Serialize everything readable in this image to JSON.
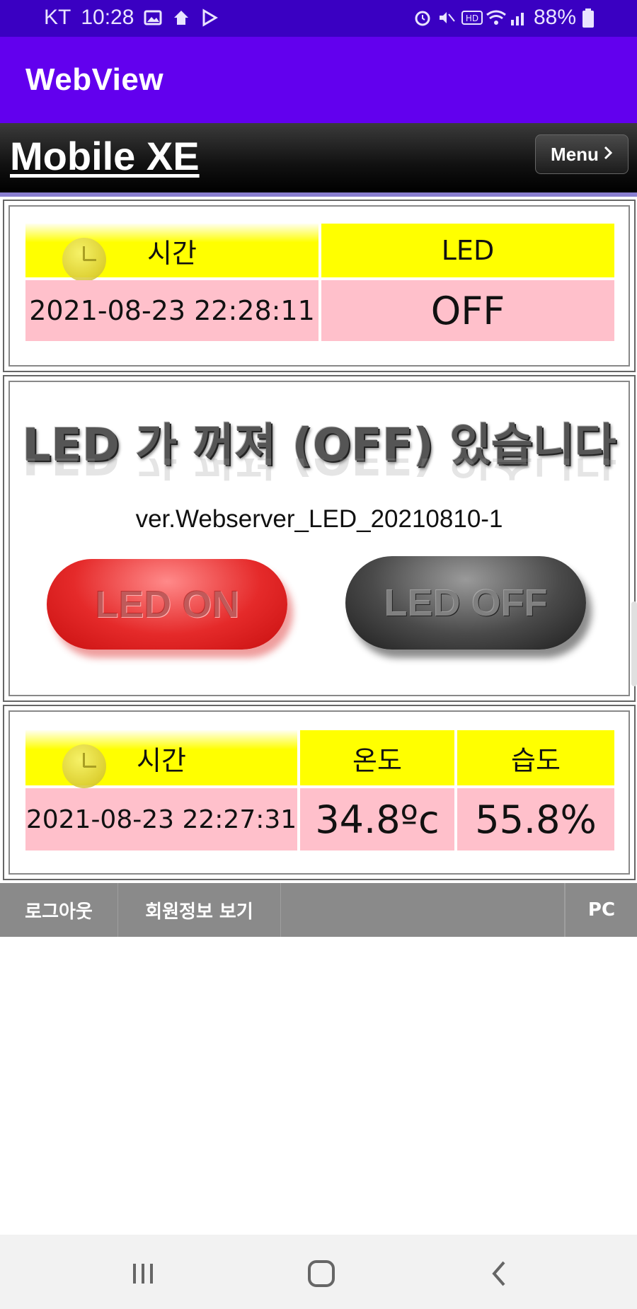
{
  "status_bar": {
    "carrier": "KT",
    "time": "10:28",
    "battery": "88%"
  },
  "app_bar": {
    "title": "WebView"
  },
  "site_header": {
    "brand": "Mobile XE",
    "menu_label": "Menu"
  },
  "led_status_table": {
    "headers": [
      "시간",
      "LED"
    ],
    "values": [
      "2021-08-23 22:28:11",
      "OFF"
    ]
  },
  "led_control": {
    "banner": "LED 가 꺼져 (OFF) 있습니다",
    "version": "ver.Webserver_LED_20210810-1",
    "on_button": "LED ON",
    "off_button": "LED OFF"
  },
  "sensor_table": {
    "headers": [
      "시간",
      "온도",
      "습도"
    ],
    "values": [
      "2021-08-23 22:27:31",
      "34.8ºc",
      "55.8%"
    ]
  },
  "footer_nav": {
    "logout": "로그아웃",
    "member_info": "회원정보 보기",
    "pc": "PC"
  },
  "colors": {
    "status_bar": "#3a00c2",
    "app_bar": "#6200ee",
    "header_yellow": "#ffff00",
    "value_pink": "#ffc0cb",
    "footer_gray": "#8a8a8a"
  }
}
